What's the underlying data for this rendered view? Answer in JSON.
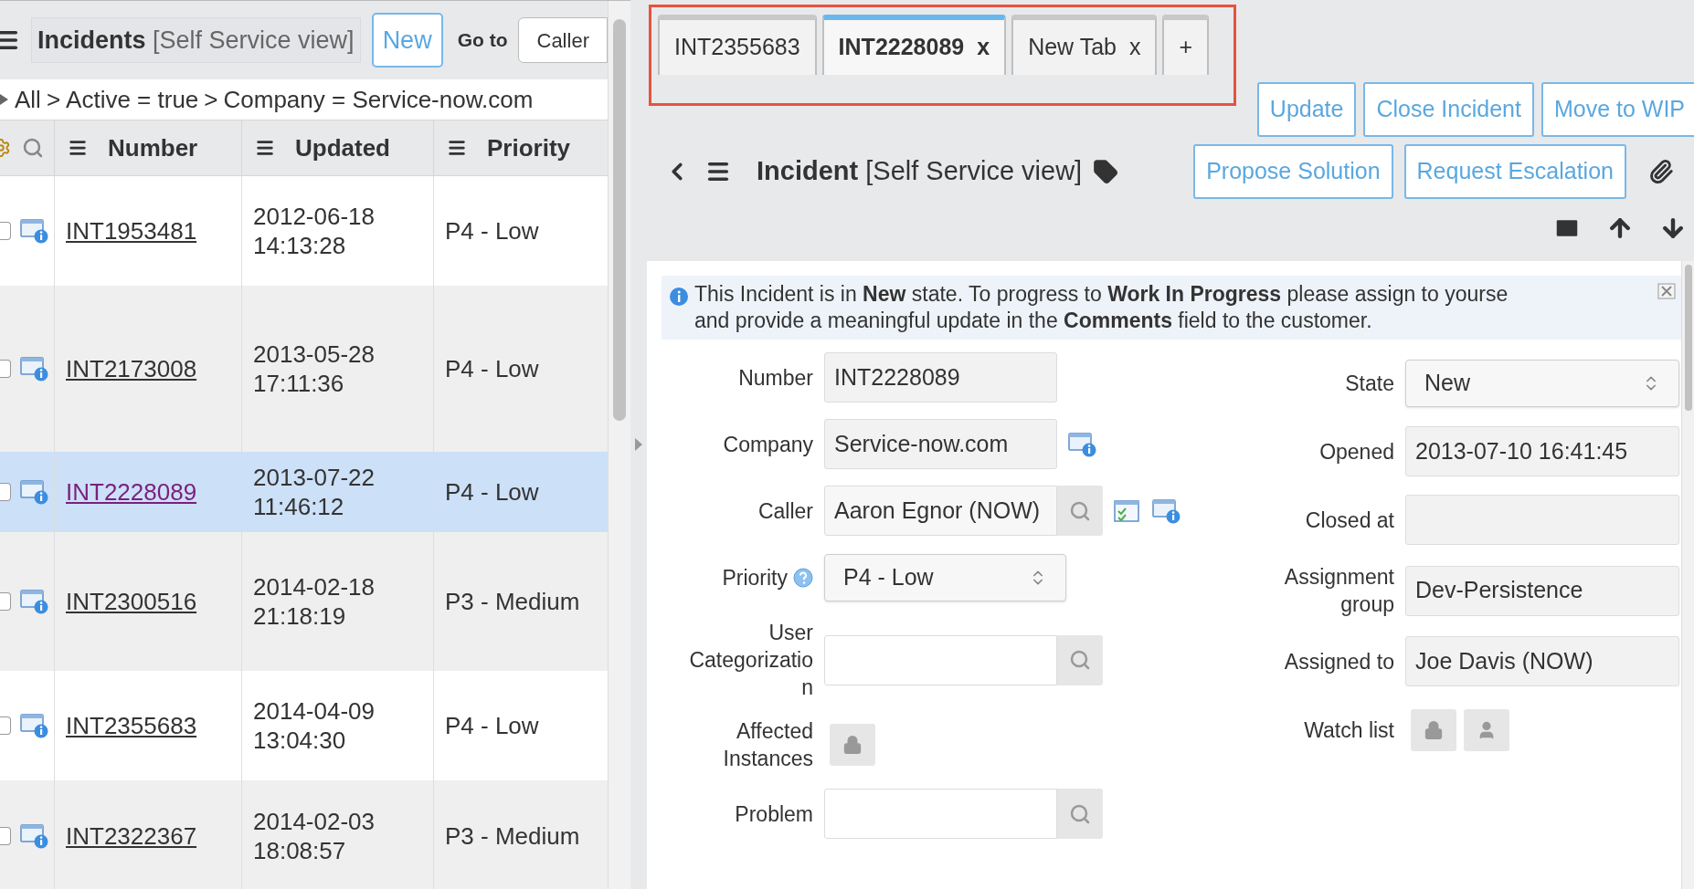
{
  "list": {
    "title": "Incidents",
    "view": "[Self Service view]",
    "new_button": "New",
    "goto_label": "Go to",
    "goto_field": "Caller",
    "breadcrumb": [
      {
        "label": "All"
      },
      {
        "separator": ">",
        "label": "Active = true"
      },
      {
        "separator": ">",
        "label": "Company = Service-now.com"
      }
    ],
    "columns": [
      "Number",
      "Updated",
      "Priority"
    ],
    "rows": [
      {
        "number": "INT1953481",
        "updated": "2012-06-18 14:13:28",
        "priority": "P4 - Low",
        "selected": false,
        "checked": false
      },
      {
        "number": "INT2173008",
        "updated": "2013-05-28 17:11:36",
        "priority": "P4 - Low",
        "selected": false,
        "checked": false
      },
      {
        "number": "INT2228089",
        "updated": "2013-07-22 11:46:12",
        "priority": "P4 - Low",
        "selected": true,
        "checked": false
      },
      {
        "number": "INT2300516",
        "updated": "2014-02-18 21:18:19",
        "priority": "P3 - Medium",
        "selected": false,
        "checked": false
      },
      {
        "number": "INT2355683",
        "updated": "2014-04-09 13:04:30",
        "priority": "P4 - Low",
        "selected": false,
        "checked": false
      },
      {
        "number": "INT2322367",
        "updated": "2014-02-03 18:08:57",
        "priority": "P3 - Medium",
        "selected": false,
        "checked": false
      }
    ]
  },
  "tabs": [
    {
      "label": "INT2355683",
      "selected": false
    },
    {
      "label": "INT2228089",
      "selected": true,
      "close": "x"
    },
    {
      "label": "New Tab",
      "selected": false,
      "close": "x"
    }
  ],
  "add_tab": "+",
  "form": {
    "title": "Incident",
    "view": "[Self Service view]",
    "action_buttons": [
      "Update",
      "Close Incident",
      "Move to WIP"
    ],
    "secondary_buttons": [
      "Propose Solution",
      "Request Escalation"
    ],
    "message_lines": [
      "This Incident is in **New** state. To progress to **Work In Progress** please assign to yourse",
      "and provide a meaningful update in the **Comments** field to the customer."
    ],
    "left_fields": [
      {
        "kind": "text",
        "label": "Number",
        "value": "INT2228089"
      },
      {
        "kind": "info",
        "label": "Company",
        "value": "Service-now.com"
      },
      {
        "kind": "reference_extra",
        "label": "Caller",
        "value": "Aaron Egnor (NOW)"
      },
      {
        "kind": "select",
        "label": "Priority",
        "value": "P4 - Low",
        "help": true
      },
      {
        "kind": "reference",
        "label": "User Categorizatio n"
      },
      {
        "kind": "lock",
        "label": "Affected Instances"
      },
      {
        "kind": "reference",
        "label": "Problem"
      }
    ],
    "right_fields": [
      {
        "kind": "select",
        "label": "State",
        "value": "New"
      },
      {
        "kind": "text",
        "label": "Opened",
        "value": "2013-07-10 16:41:45"
      },
      {
        "kind": "text",
        "label": "Closed at"
      },
      {
        "kind": "text",
        "label": "Assignment group",
        "value": "Dev-Persistence"
      },
      {
        "kind": "text",
        "label": "Assigned to",
        "value": "Joe Davis (NOW)"
      },
      {
        "kind": "watchlist",
        "label": "Watch list"
      }
    ]
  }
}
